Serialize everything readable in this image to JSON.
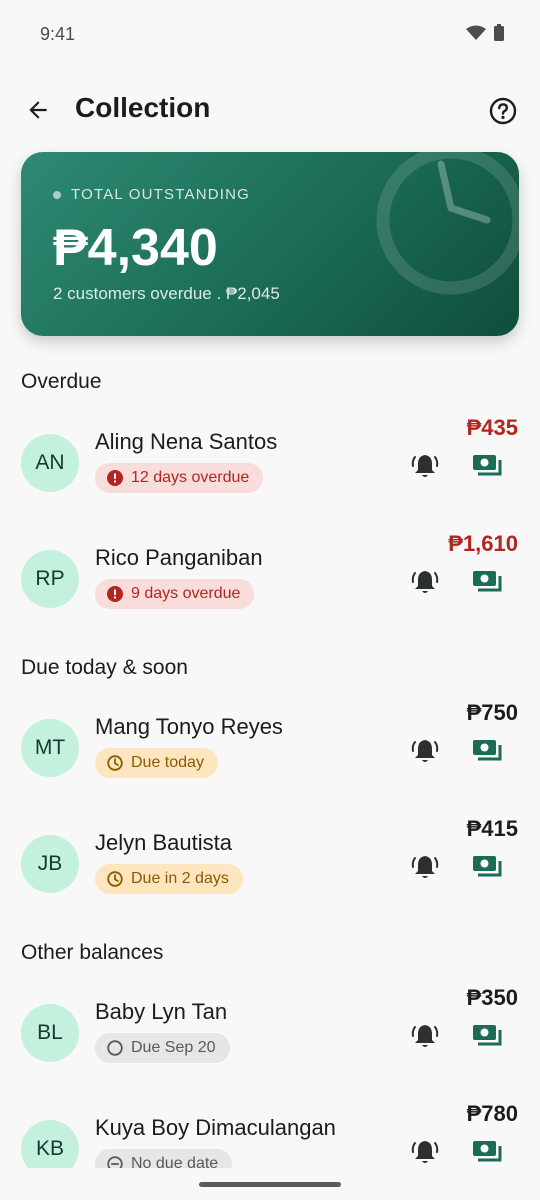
{
  "status": {
    "time": "9:41",
    "icons": [
      "wifi-icon",
      "battery-icon"
    ]
  },
  "header": {
    "title": "Collection",
    "back_icon": "arrow-left-icon",
    "help_icon": "help-circle-icon"
  },
  "summary": {
    "label": "TOTAL OUTSTANDING",
    "amount": "₱4,340",
    "subtitle": "2 customers overdue . ₱2,045"
  },
  "sections": {
    "overdue": "Overdue",
    "due_soon": "Due today & soon",
    "other": "Other balances"
  },
  "customers": [
    {
      "initials": "AN",
      "name": "Aling Nena Santos",
      "status": "12 days overdue",
      "amount": "₱435"
    },
    {
      "initials": "RP",
      "name": "Rico Panganiban",
      "status": "9 days overdue",
      "amount": "₱1,610"
    },
    {
      "initials": "MT",
      "name": "Mang Tonyo Reyes",
      "status": "Due today",
      "amount": "₱750"
    },
    {
      "initials": "JB",
      "name": "Jelyn Bautista",
      "status": "Due in 2 days",
      "amount": "₱415"
    },
    {
      "initials": "BL",
      "name": "Baby Lyn Tan",
      "status": "Due Sep 20",
      "amount": "₱350"
    },
    {
      "initials": "KB",
      "name": "Kuya Boy Dimaculangan",
      "status": "No due date",
      "amount": "₱780"
    }
  ],
  "colors": {
    "accent": "#1b6b55",
    "overdue": "#b3261e",
    "due": "#8a5a00",
    "avatar": "#c4f1dd"
  }
}
